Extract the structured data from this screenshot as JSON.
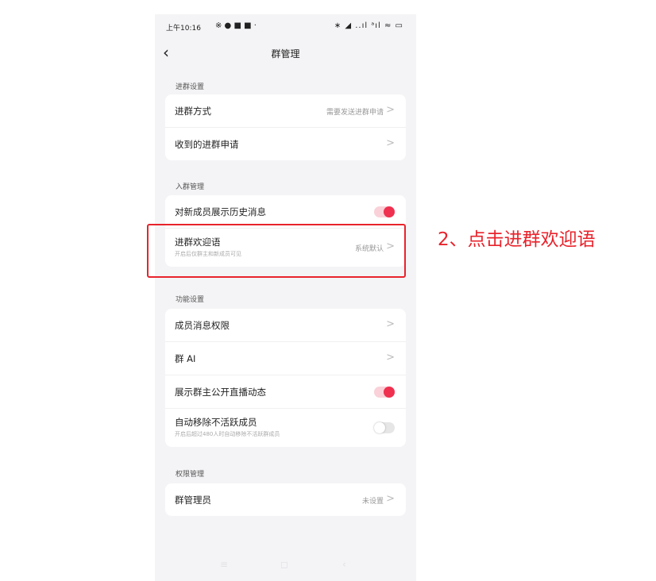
{
  "status_bar": {
    "time": "上午10:16",
    "left_icons": "※ ● ■ ■ ·",
    "right_icons": "∗ ◢ ..ıl ᵃıl ≈ ▭"
  },
  "header": {
    "back": "‹",
    "title": "群管理"
  },
  "sections": {
    "join": {
      "title": "进群设置",
      "join_method": {
        "label": "进群方式",
        "value": "需要发送进群申请",
        "chevron": ">"
      },
      "received_requests": {
        "label": "收到的进群申请",
        "chevron": ">"
      }
    },
    "entry": {
      "title": "入群管理",
      "show_history": {
        "label": "对新成员展示历史消息",
        "toggle": "on"
      },
      "welcome": {
        "label": "进群欢迎语",
        "subtitle": "开启后仅群主和新成员可见",
        "value": "系统默认",
        "chevron": ">"
      }
    },
    "features": {
      "title": "功能设置",
      "member_permissions": {
        "label": "成员消息权限",
        "chevron": ">"
      },
      "group_ai": {
        "label": "群 AI",
        "chevron": ">"
      },
      "show_live": {
        "label": "展示群主公开直播动态",
        "toggle": "on"
      },
      "auto_remove": {
        "label": "自动移除不活跃成员",
        "subtitle": "开启后超过480人时自动移除不活跃群成员",
        "toggle": "off"
      }
    },
    "permissions": {
      "title": "权限管理",
      "admins": {
        "label": "群管理员",
        "value": "未设置",
        "chevron": ">"
      }
    }
  },
  "nav_bar": {
    "menu": "≡",
    "home": "◻",
    "back": "‹"
  },
  "annotation": {
    "text": "2、点击进群欢迎语",
    "color": "#e8232c"
  },
  "colors": {
    "accent": "#f0304f",
    "background": "#f4f4f6"
  }
}
